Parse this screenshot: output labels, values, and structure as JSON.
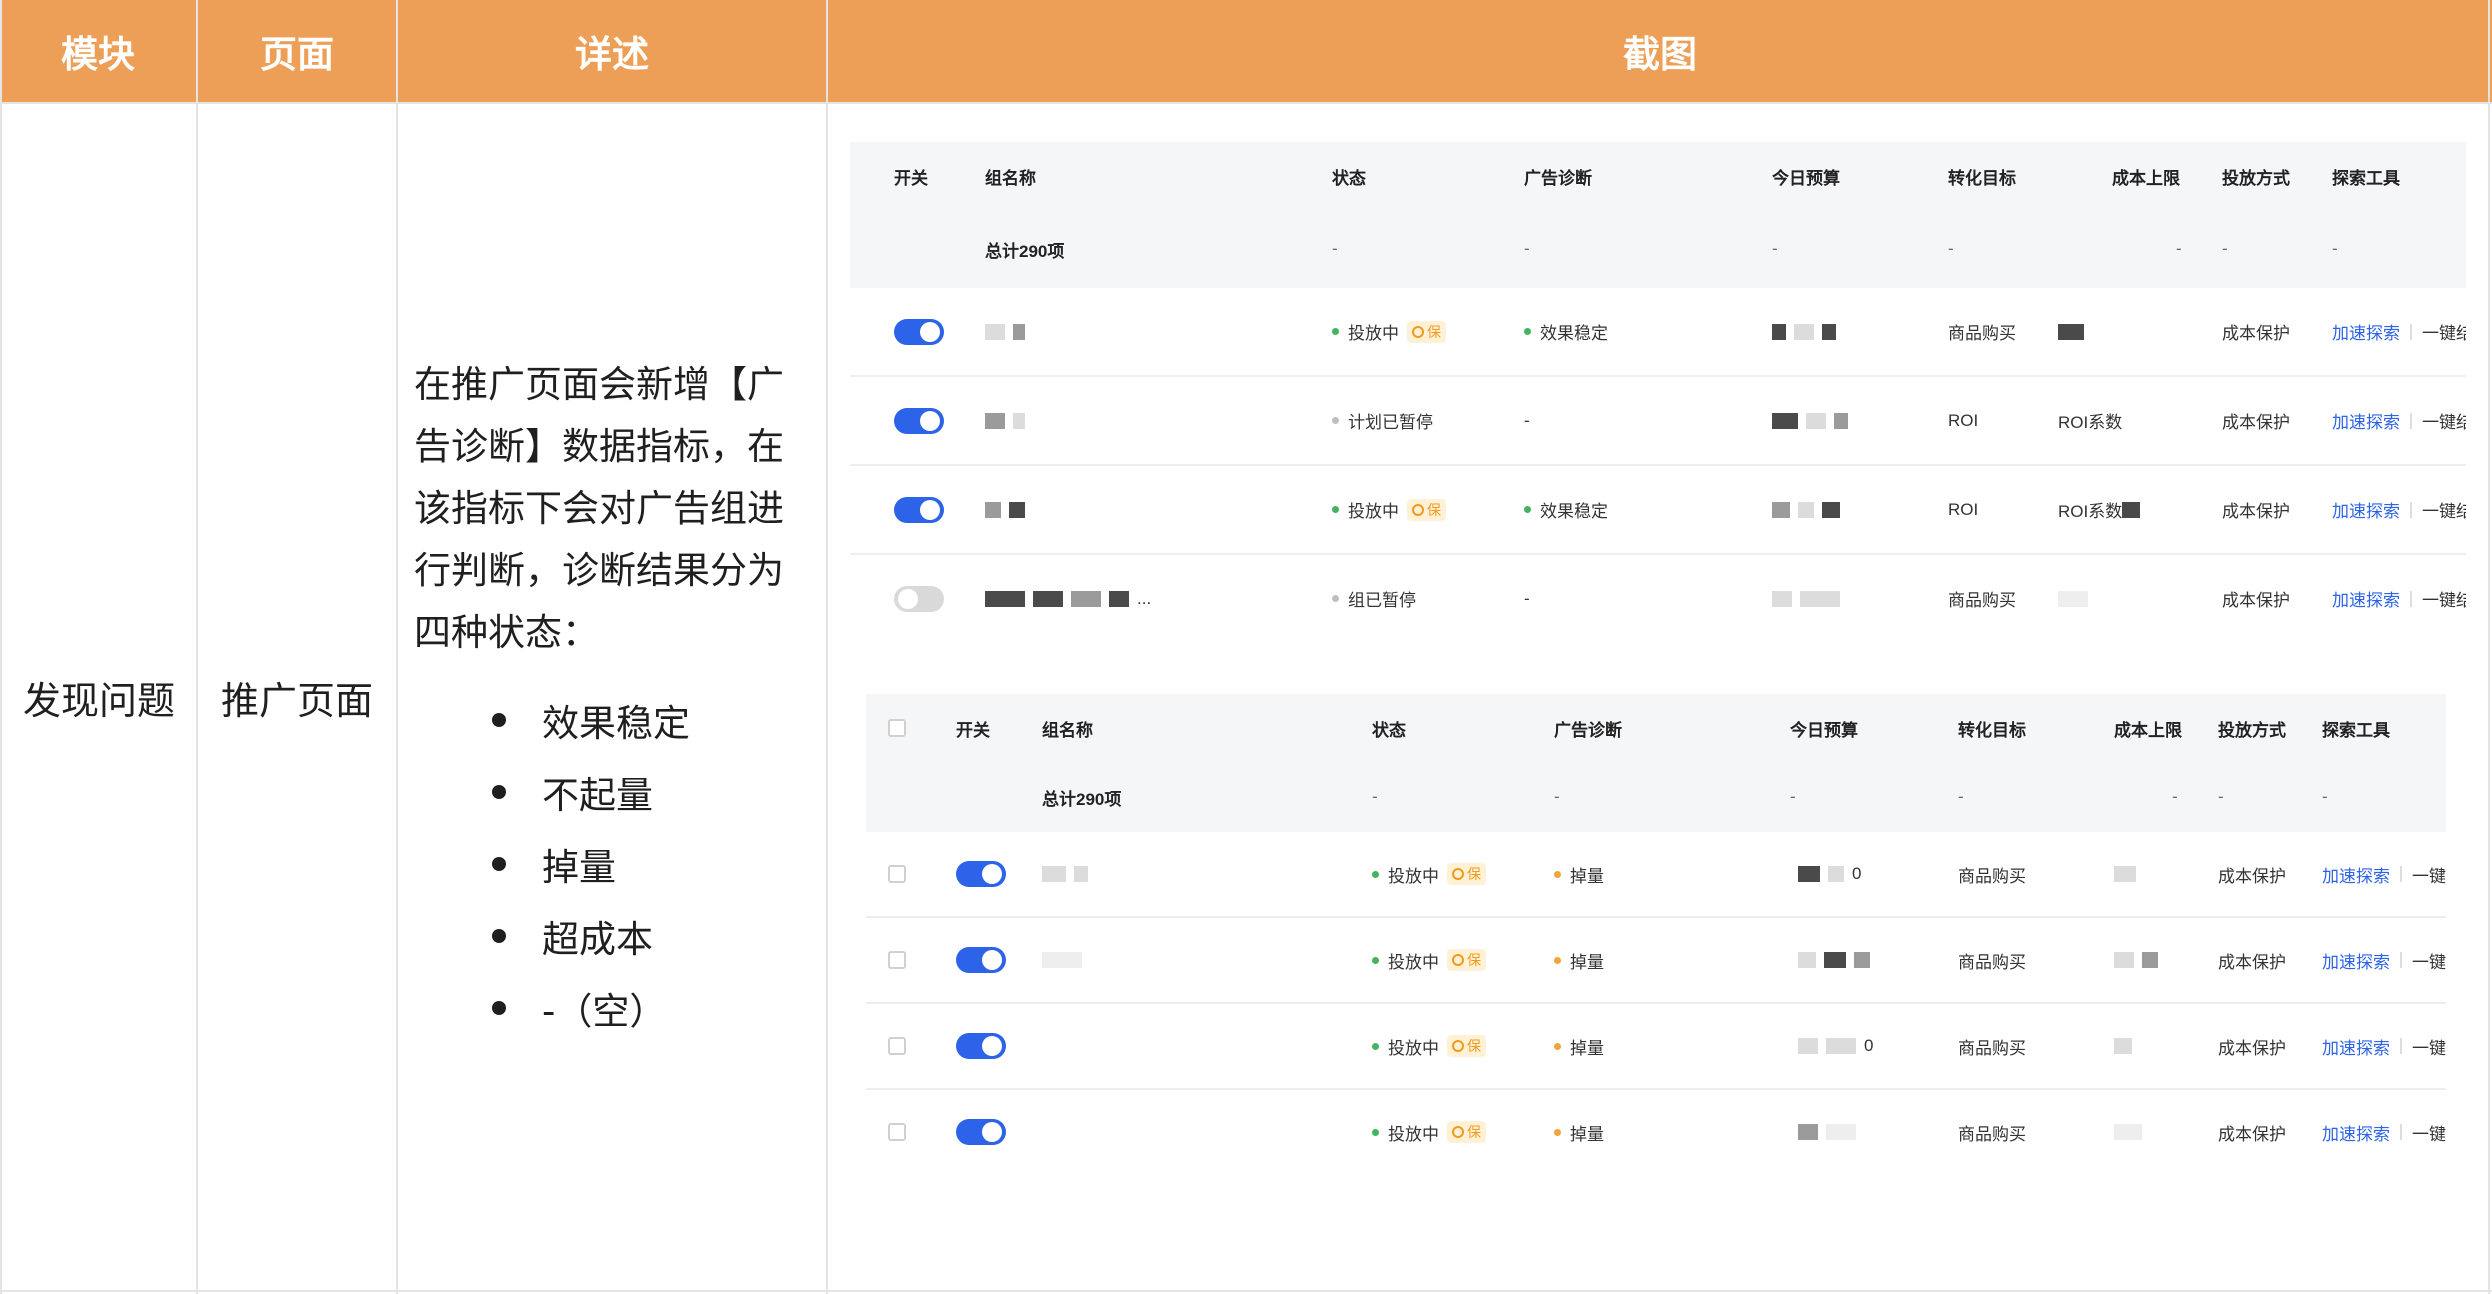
{
  "outer_table": {
    "headers": {
      "module": "模块",
      "page": "页面",
      "detail": "详述",
      "screenshot": "截图"
    },
    "module": "发现问题",
    "page": "推广页面",
    "description": "在推广页面会新增【广告诊断】数据指标，在该指标下会对广告组进行判断，诊断结果分为四种状态：",
    "states": [
      "效果稳定",
      "不起量",
      "掉量",
      "超成本",
      "-（空）"
    ]
  },
  "shot1": {
    "columns": [
      "开关",
      "组名称",
      "状态",
      "广告诊断",
      "今日预算",
      "转化目标",
      "成本上限",
      "投放方式",
      "探索工具"
    ],
    "total": {
      "label": "总计290项",
      "dash": "-"
    },
    "rows": [
      {
        "on": true,
        "status": "投放中",
        "status_color": "#43b35e",
        "bao": true,
        "diag": "效果稳定",
        "diag_color": "#43b35e",
        "goal": "商品购买",
        "cost": "",
        "method": "成本保护",
        "tool": "加速探索",
        "tool2": "一键结"
      },
      {
        "on": true,
        "status": "计划已暂停",
        "status_color": "#bfbfbf",
        "bao": false,
        "diag": "-",
        "diag_color": "",
        "goal": "ROI",
        "cost": "ROI系数",
        "method": "成本保护",
        "tool": "加速探索",
        "tool2": "一键结"
      },
      {
        "on": true,
        "status": "投放中",
        "status_color": "#43b35e",
        "bao": true,
        "diag": "效果稳定",
        "diag_color": "#43b35e",
        "goal": "ROI",
        "cost": "ROI系数",
        "method": "成本保护",
        "tool": "加速探索",
        "tool2": "一键结"
      },
      {
        "on": false,
        "status": "组已暂停",
        "status_color": "#bfbfbf",
        "bao": false,
        "diag": "-",
        "diag_color": "",
        "goal": "商品购买",
        "cost": "",
        "method": "成本保护",
        "tool": "加速探索",
        "tool2": "一键结"
      }
    ],
    "name_suffix": "..."
  },
  "shot2": {
    "columns": [
      "开关",
      "组名称",
      "状态",
      "广告诊断",
      "今日预算",
      "转化目标",
      "成本上限",
      "投放方式",
      "探索工具"
    ],
    "total": {
      "label": "总计290项",
      "dash": "-"
    },
    "bao_label": "保",
    "rows": [
      {
        "on": true,
        "status": "投放中",
        "diag": "掉量",
        "budget_tail": "0",
        "goal": "商品购买",
        "method": "成本保护",
        "tool": "加速探索",
        "tool2": "一键结"
      },
      {
        "on": true,
        "status": "投放中",
        "diag": "掉量",
        "budget_tail": "",
        "goal": "商品购买",
        "method": "成本保护",
        "tool": "加速探索",
        "tool2": "一键结"
      },
      {
        "on": true,
        "status": "投放中",
        "diag": "掉量",
        "budget_tail": "0",
        "goal": "商品购买",
        "method": "成本保护",
        "tool": "加速探索",
        "tool2": "一键结"
      },
      {
        "on": true,
        "status": "投放中",
        "diag": "掉量",
        "budget_tail": "",
        "goal": "商品购买",
        "method": "成本保护",
        "tool": "加速探索",
        "tool2": "一键结"
      }
    ]
  },
  "colors": {
    "header_orange": "#ee9f57",
    "toggle_on": "#2c63e8",
    "link": "#2c63e8",
    "green": "#43b35e",
    "orange_dot": "#f2a33a"
  }
}
